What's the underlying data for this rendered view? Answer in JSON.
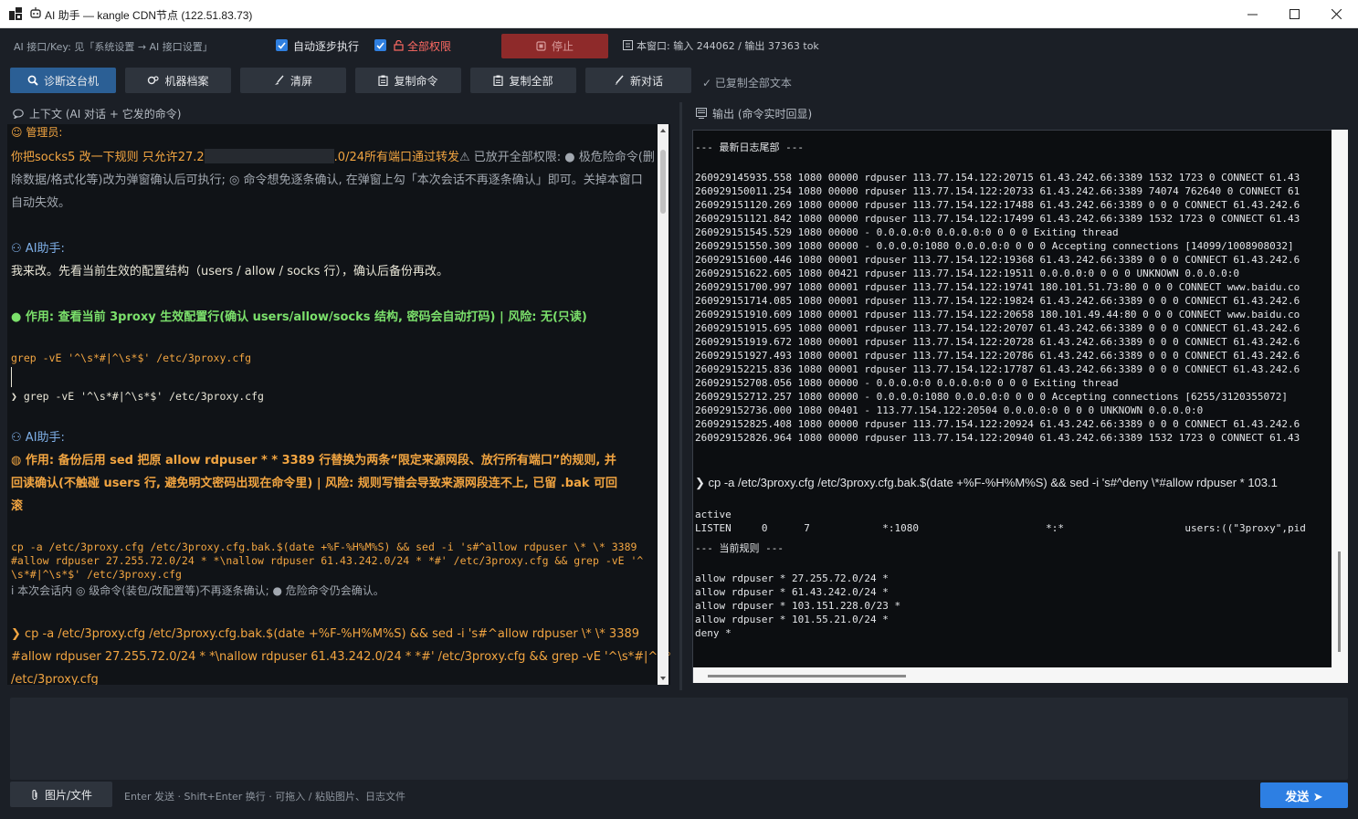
{
  "window": {
    "title": "AI 助手 — kangle CDN节点 (122.51.83.73)"
  },
  "topbar": {
    "api_note": "AI 接口/Key: 见「系统设置 → AI 接口设置」",
    "auto_step_label": "自动逐步执行",
    "full_perm_label": "全部权限",
    "stop_label": "停止",
    "window_stats": "本窗口: 输入 244062 / 输出 37363 tok"
  },
  "toolbar": {
    "diagnose": "诊断这台机",
    "profile": "机器档案",
    "clear": "清屏",
    "copy_cmd": "复制命令",
    "copy_all": "复制全部",
    "new_chat": "新对话",
    "copied_status": "✓ 已复制全部文本"
  },
  "context_pane": {
    "header": "上下文 (AI 对话 + 它发的命令)",
    "admin_label": "管理员:",
    "admin_msg_1a": "你把socks5 改一下规则 只允许27.2",
    "admin_msg_1b": ".0/24所有端口通过转发",
    "perm_note_1": "⚠ 已放开全部权限: ● 极危险命令(删",
    "perm_note_2": "除数据/格式化等)改为弹窗确认后可执行; ◎ 命令想免逐条确认, 在弹窗上勾「本次会话不再逐条确认」即可。关掉本窗口",
    "perm_note_3": "自动失效。",
    "ai_label_1": "AI助手:",
    "ai_msg_1": "我来改。先看当前生效的配置结构（users / allow / socks 行），确认后备份再改。",
    "action_1": "● 作用:  查看当前 3proxy 生效配置行(确认 users/allow/socks 结构, 密码会自动打码) | 风险:  无(只读)",
    "cmd_1": "grep -vE '^\\s*#|^\\s*$' /etc/3proxy.cfg",
    "cmd_1_run": "❯ grep -vE '^\\s*#|^\\s*$' /etc/3proxy.cfg",
    "ai_label_2": "AI助手:",
    "action_2_l1": "◍ 作用: 备份后用 sed 把原 allow rdpuser * * 3389 行替换为两条“限定来源网段、放行所有端口”的规则, 并",
    "action_2_l2": "回读确认(不触碰 users 行, 避免明文密码出现在命令里) | 风险: 规则写错会导致来源网段连不上, 已留 .bak 可回",
    "action_2_l3": "滚",
    "cmd_2_l1": "cp -a /etc/3proxy.cfg /etc/3proxy.cfg.bak.$(date +%F-%H%M%S) && sed -i 's#^allow rdpuser \\* \\* 3389",
    "cmd_2_l2": "#allow rdpuser 27.255.72.0/24 * *\\nallow rdpuser 61.43.242.0/24 * *#' /etc/3proxy.cfg && grep -vE '^",
    "cmd_2_l3": "\\s*#|^\\s*$' /etc/3proxy.cfg",
    "session_note": "ⅰ 本次会话内 ◎ 级命令(装包/改配置等)不再逐条确认; ● 危险命令仍会确认。",
    "cmd_2_run_l1": "❯ cp -a /etc/3proxy.cfg /etc/3proxy.cfg.bak.$(date +%F-%H%M%S) && sed -i 's#^allow rdpuser \\* \\* 3389",
    "cmd_2_run_l2": "#allow rdpuser 27.255.72.0/24 * *\\nallow rdpuser 61.43.242.0/24 * *#' /etc/3proxy.cfg && grep -vE '^\\s*#|^\\s*$'",
    "cmd_2_run_l3": "/etc/3proxy.cfg"
  },
  "output_pane": {
    "header": "输出 (命令实时回显)",
    "log_title": "--- 最新日志尾部 ---",
    "log_lines": [
      "260929145935.558 1080 00000 rdpuser 113.77.154.122:20715 61.43.242.66:3389 1532 1723 0 CONNECT 61.43",
      "260929150011.254 1080 00000 rdpuser 113.77.154.122:20733 61.43.242.66:3389 74074 762640 0 CONNECT 61",
      "260929151120.269 1080 00000 rdpuser 113.77.154.122:17488 61.43.242.66:3389 0 0 0 CONNECT 61.43.242.6",
      "260929151121.842 1080 00000 rdpuser 113.77.154.122:17499 61.43.242.66:3389 1532 1723 0 CONNECT 61.43",
      "260929151545.529 1080 00000 - 0.0.0.0:0 0.0.0.0:0 0 0 0 Exiting thread",
      "260929151550.309 1080 00000 - 0.0.0.0:1080 0.0.0.0:0 0 0 0 Accepting connections [14099/1008908032]",
      "260929151600.446 1080 00001 rdpuser 113.77.154.122:19368 61.43.242.66:3389 0 0 0 CONNECT 61.43.242.6",
      "260929151622.605 1080 00421 rdpuser 113.77.154.122:19511 0.0.0.0:0 0 0 0 UNKNOWN 0.0.0.0:0",
      "260929151700.997 1080 00001 rdpuser 113.77.154.122:19741 180.101.51.73:80 0 0 0 CONNECT www.baidu.co",
      "260929151714.085 1080 00001 rdpuser 113.77.154.122:19824 61.43.242.66:3389 0 0 0 CONNECT 61.43.242.6",
      "260929151910.609 1080 00001 rdpuser 113.77.154.122:20658 180.101.49.44:80 0 0 0 CONNECT www.baidu.co",
      "260929151915.695 1080 00001 rdpuser 113.77.154.122:20707 61.43.242.66:3389 0 0 0 CONNECT 61.43.242.6",
      "260929151919.672 1080 00001 rdpuser 113.77.154.122:20728 61.43.242.66:3389 0 0 0 CONNECT 61.43.242.6",
      "260929151927.493 1080 00001 rdpuser 113.77.154.122:20786 61.43.242.66:3389 0 0 0 CONNECT 61.43.242.6",
      "260929152215.836 1080 00001 rdpuser 113.77.154.122:17787 61.43.242.66:3389 0 0 0 CONNECT 61.43.242.6",
      "260929152708.056 1080 00000 - 0.0.0.0:0 0.0.0.0:0 0 0 0 Exiting thread",
      "260929152712.257 1080 00000 - 0.0.0.0:1080 0.0.0.0:0 0 0 0 Accepting connections [6255/3120355072]",
      "260929152736.000 1080 00401 - 113.77.154.122:20504 0.0.0.0:0 0 0 0 UNKNOWN 0.0.0.0:0",
      "260929152825.408 1080 00000 rdpuser 113.77.154.122:20924 61.43.242.66:3389 0 0 0 CONNECT 61.43.242.6",
      "260929152826.964 1080 00000 rdpuser 113.77.154.122:20940 61.43.242.66:3389 1532 1723 0 CONNECT 61.43"
    ],
    "cmd_line": "❯ cp -a /etc/3proxy.cfg /etc/3proxy.cfg.bak.$(date +%F-%H%M%S) && sed -i 's#^deny \\*#allow rdpuser * 103.1",
    "active": "active",
    "listen": "LISTEN     0      7            *:1080                     *:*                    users:((\"3proxy\",pid",
    "rules_title": "--- 当前规则 ---",
    "rules": [
      "allow rdpuser * 27.255.72.0/24 *",
      "allow rdpuser * 61.43.242.0/24 *",
      "allow rdpuser * 103.151.228.0/23 *",
      "allow rdpuser * 101.55.21.0/24 *",
      "deny *"
    ]
  },
  "composer": {
    "attach_label": "图片/文件",
    "hint": "Enter 发送 · Shift+Enter 换行 · 可拖入 / 粘贴图片、日志文件",
    "send_label": "发送 ➤"
  }
}
